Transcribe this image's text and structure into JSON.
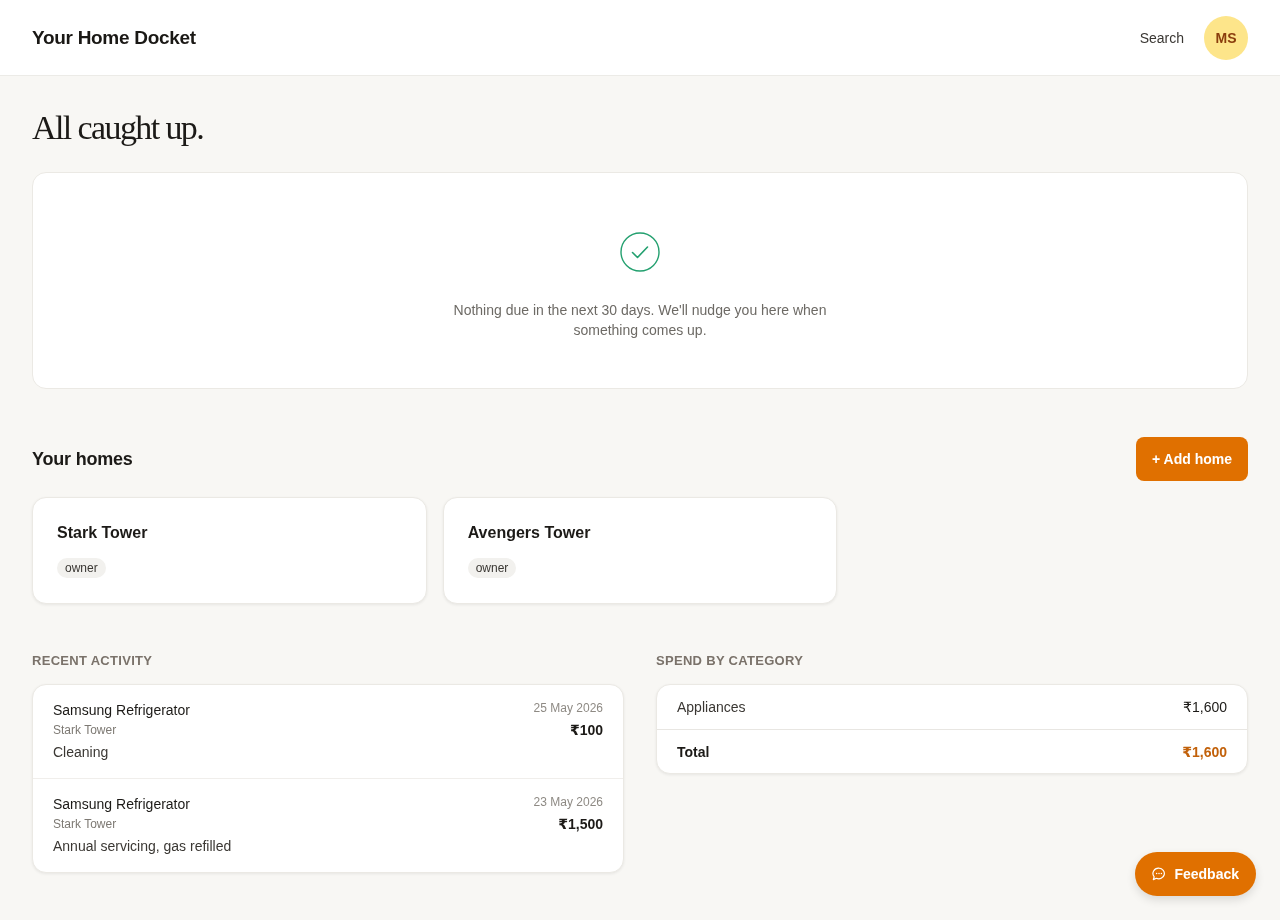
{
  "header": {
    "title": "Your Home Docket",
    "search": "Search",
    "avatar": "MS"
  },
  "heading": "All caught up.",
  "status_card": {
    "message": "Nothing due in the next 30 days. We'll nudge you here when something comes up."
  },
  "homes": {
    "title": "Your homes",
    "add_button": "+ Add home",
    "items": [
      {
        "name": "Stark Tower",
        "role": "owner"
      },
      {
        "name": "Avengers Tower",
        "role": "owner"
      }
    ]
  },
  "recent_activity": {
    "title": "RECENT ACTIVITY",
    "items": [
      {
        "item": "Samsung Refrigerator",
        "home": "Stark Tower",
        "note": "Cleaning",
        "date": "25 May 2026",
        "amount": "₹100"
      },
      {
        "item": "Samsung Refrigerator",
        "home": "Stark Tower",
        "note": "Annual servicing, gas refilled",
        "date": "23 May 2026",
        "amount": "₹1,500"
      }
    ]
  },
  "spend_by_category": {
    "title": "SPEND BY CATEGORY",
    "rows": [
      {
        "kind": "category",
        "label": "Appliances",
        "amount": "₹1,600"
      },
      {
        "kind": "total",
        "label": "Total",
        "amount": "₹1,600"
      }
    ]
  },
  "feedback_button": "Feedback"
}
